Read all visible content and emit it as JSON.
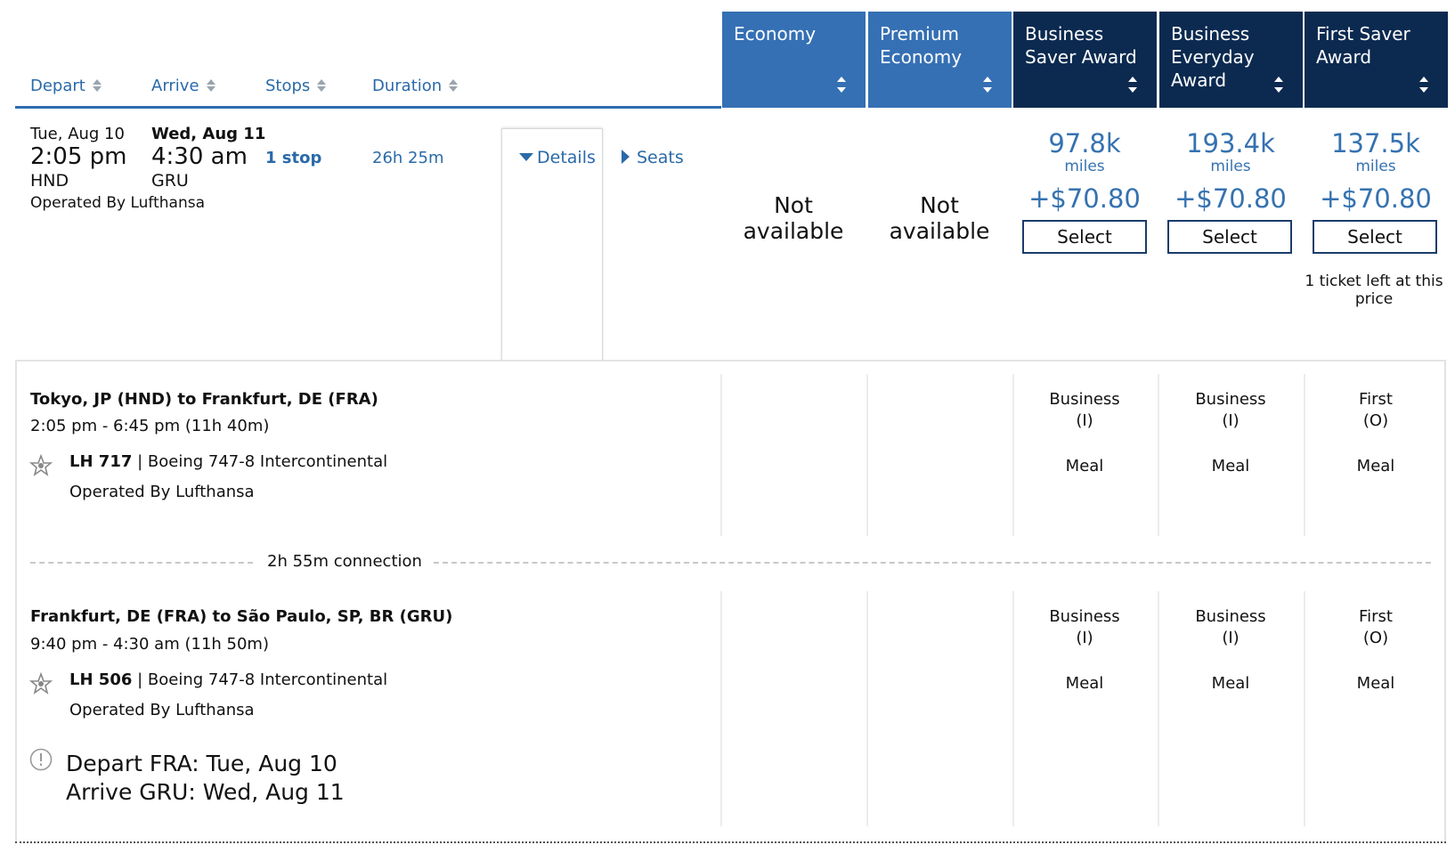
{
  "header": {
    "sort_columns": [
      "Depart",
      "Arrive",
      "Stops",
      "Duration"
    ],
    "fare_columns": [
      {
        "label": "Economy"
      },
      {
        "label": "Premium\nEconomy"
      },
      {
        "label": "Business\nSaver Award"
      },
      {
        "label": "Business\nEveryday\nAward"
      },
      {
        "label": "First Saver\nAward"
      }
    ]
  },
  "flight": {
    "depart_date": "Tue, Aug 10",
    "depart_time": "2:05 pm",
    "depart_airport": "HND",
    "arrive_date": "Wed, Aug 11",
    "arrive_time": "4:30 am",
    "arrive_airport": "GRU",
    "operator": "Operated By Lufthansa",
    "stops": "1 stop",
    "duration": "26h 25m",
    "details_label": "Details",
    "seats_label": "Seats",
    "fares": [
      {
        "available": false,
        "text": "Not available"
      },
      {
        "available": false,
        "text": "Not available"
      },
      {
        "available": true,
        "miles": "97.8k",
        "unit": "miles",
        "tax": "+$70.80",
        "button": "Select"
      },
      {
        "available": true,
        "miles": "193.4k",
        "unit": "miles",
        "tax": "+$70.80",
        "button": "Select"
      },
      {
        "available": true,
        "miles": "137.5k",
        "unit": "miles",
        "tax": "+$70.80",
        "button": "Select",
        "note": "1 ticket left at this price"
      }
    ]
  },
  "segments": [
    {
      "route": "Tokyo, JP (HND) to Frankfurt, DE (FRA)",
      "times": "2:05 pm - 6:45 pm (11h 40m)",
      "flight_no": "LH 717",
      "aircraft": " | Boeing 747-8 Intercontinental",
      "operator": "Operated By Lufthansa",
      "cabins": [
        {
          "cabin": "Business",
          "code": "(I)",
          "meal": "Meal"
        },
        {
          "cabin": "Business",
          "code": "(I)",
          "meal": "Meal"
        },
        {
          "cabin": "First",
          "code": "(O)",
          "meal": "Meal"
        }
      ]
    },
    {
      "route": "Frankfurt, DE (FRA) to São Paulo, SP, BR (GRU)",
      "times": "9:40 pm - 4:30 am (11h 50m)",
      "flight_no": "LH 506",
      "aircraft": " | Boeing 747-8 Intercontinental",
      "operator": "Operated By Lufthansa",
      "cabins": [
        {
          "cabin": "Business",
          "code": "(I)",
          "meal": "Meal"
        },
        {
          "cabin": "Business",
          "code": "(I)",
          "meal": "Meal"
        },
        {
          "cabin": "First",
          "code": "(O)",
          "meal": "Meal"
        }
      ]
    }
  ],
  "connection": "2h 55m connection",
  "warning": {
    "line1": "Depart FRA: Tue, Aug 10",
    "line2": "Arrive GRU: Wed, Aug 11"
  },
  "icons": {
    "star_alliance": "star-alliance-icon",
    "warning": "exclamation-circle-icon",
    "sort": "sort-arrows-icon"
  },
  "colors": {
    "link_blue": "#2a6aa8",
    "economy_header": "#3570b4",
    "award_header": "#0c2a50",
    "price_blue": "#3572b0"
  }
}
